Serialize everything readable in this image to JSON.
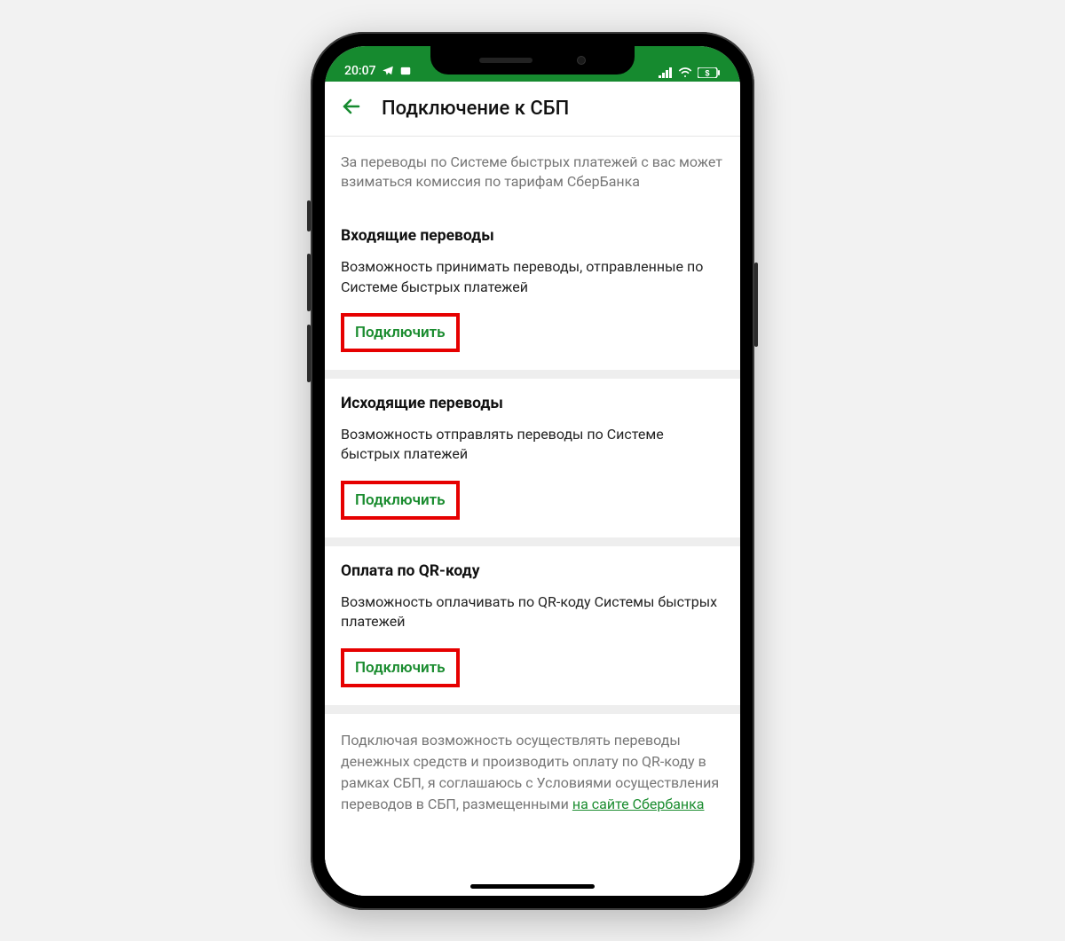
{
  "status": {
    "time": "20:07",
    "icons_left": [
      "telegram-icon",
      "message-icon"
    ],
    "icons_right": [
      "signal-icon",
      "wifi-icon",
      "battery-icon"
    ]
  },
  "header": {
    "title": "Подключение к СБП"
  },
  "info": "За переводы по Системе быстрых платежей с вас может взиматься комиссия по тарифам СберБанка",
  "sections": [
    {
      "title": "Входящие переводы",
      "desc": "Возможность принимать переводы, отправленные по Системе быстрых платежей",
      "action": "Подключить"
    },
    {
      "title": "Исходящие переводы",
      "desc": "Возможность отправлять переводы по Системе быстрых платежей",
      "action": "Подключить"
    },
    {
      "title": "Оплата по QR-коду",
      "desc": "Возможность оплачивать по QR-коду Системы быстрых платежей",
      "action": "Подключить"
    }
  ],
  "footer": {
    "text": "Подключая возможность осуществлять переводы денежных средств и производить оплату по QR-коду в рамках СБП, я соглашаюсь с Условиями осуществления переводов в СБП, размещенными ",
    "link": "на сайте Сбербанка"
  }
}
